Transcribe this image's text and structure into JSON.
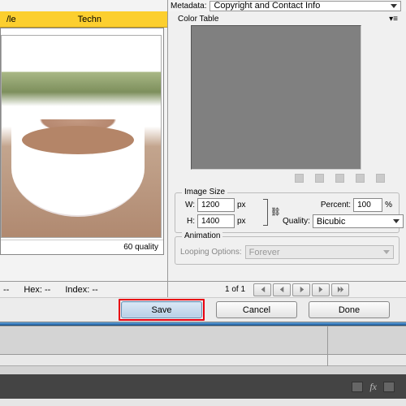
{
  "metadata": {
    "label": "Metadata:",
    "value": "Copyright and Contact Info"
  },
  "colorTable": {
    "label": "Color Table"
  },
  "preview": {
    "tab_style": "/le",
    "tab_partial": "Techn",
    "quality_text": "60 quality"
  },
  "imageSize": {
    "title": "Image Size",
    "w_label": "W:",
    "w_value": "1200",
    "w_unit": "px",
    "h_label": "H:",
    "h_value": "1400",
    "h_unit": "px",
    "percent_label": "Percent:",
    "percent_value": "100",
    "percent_sign": "%",
    "quality_label": "Quality:",
    "quality_value": "Bicubic"
  },
  "animation": {
    "title": "Animation",
    "looping_label": "Looping Options:",
    "looping_value": "Forever"
  },
  "status": {
    "dash1": "--",
    "hex": "Hex: --",
    "index": "Index: --",
    "nav_count": "1 of 1"
  },
  "buttons": {
    "save": "Save",
    "cancel": "Cancel",
    "done": "Done"
  },
  "bottomStrip": {
    "fx": "fx"
  }
}
